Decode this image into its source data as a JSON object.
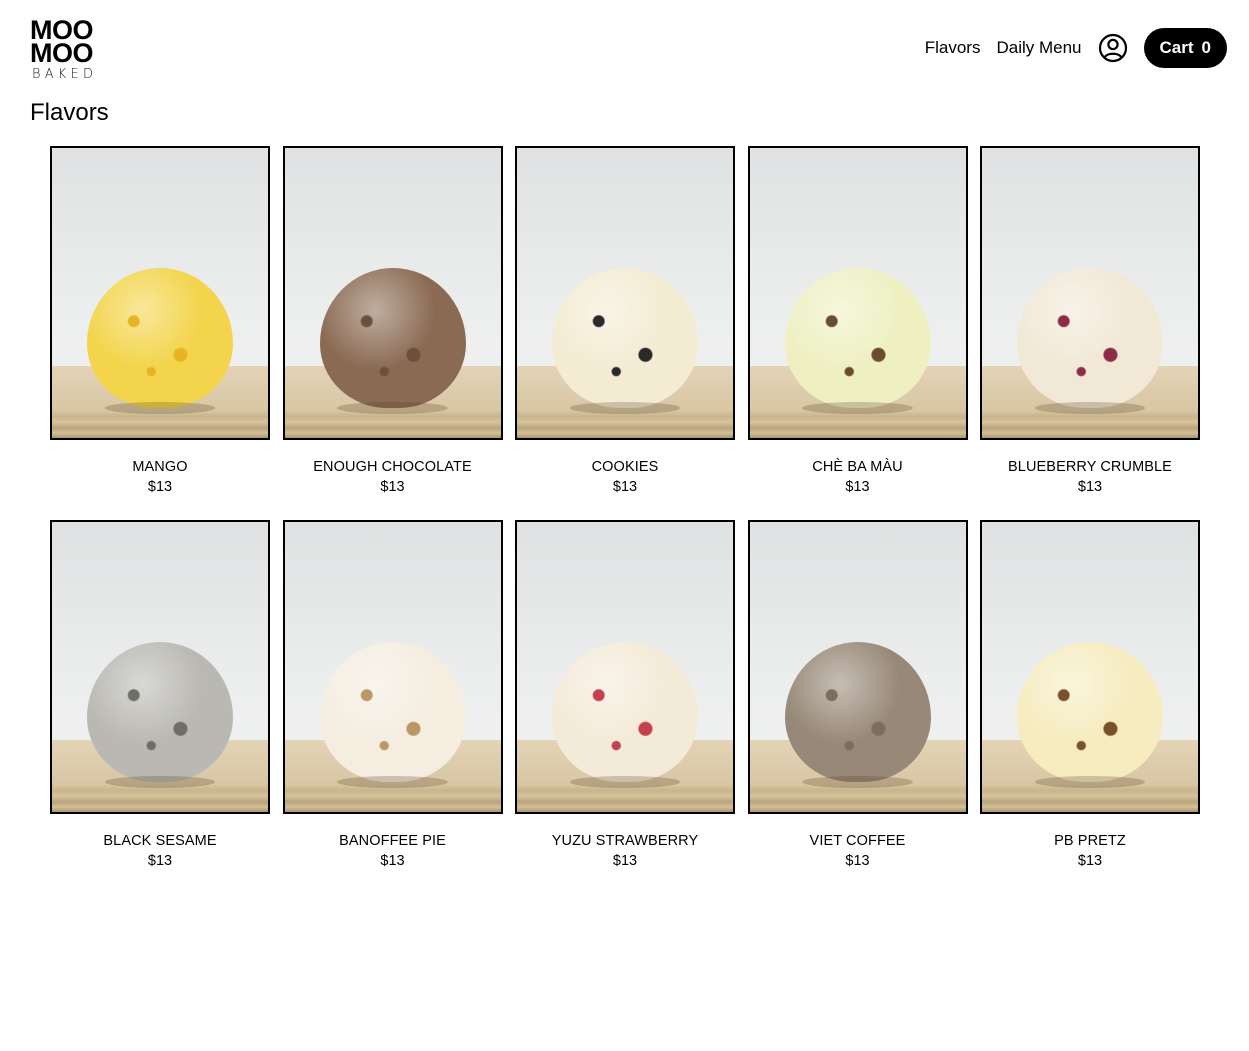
{
  "logo": {
    "line1": "MOO",
    "line2": "MOO",
    "line3": "BAKED"
  },
  "nav": {
    "flavors": "Flavors",
    "daily_menu": "Daily Menu",
    "cart_label": "Cart",
    "cart_count": "0"
  },
  "page": {
    "title": "Flavors"
  },
  "products": [
    {
      "name": "MANGO",
      "price": "$13",
      "color": "#f3d44a",
      "accent": "#e7b524"
    },
    {
      "name": "ENOUGH CHOCOLATE",
      "price": "$13",
      "color": "#8a6a52",
      "accent": "#6d4f3a"
    },
    {
      "name": "COOKIES",
      "price": "$13",
      "color": "#f3ecd3",
      "accent": "#2a2a2a"
    },
    {
      "name": "CHÈ BA MÀU",
      "price": "$13",
      "color": "#eef0c2",
      "accent": "#6b4c2e"
    },
    {
      "name": "BLUEBERRY CRUMBLE",
      "price": "$13",
      "color": "#f1e8d6",
      "accent": "#8e2c48"
    },
    {
      "name": "BLACK SESAME",
      "price": "$13",
      "color": "#b9b8b2",
      "accent": "#6e6d66"
    },
    {
      "name": "BANOFFEE PIE",
      "price": "$13",
      "color": "#f4ede0",
      "accent": "#b99866"
    },
    {
      "name": "YUZU STRAWBERRY",
      "price": "$13",
      "color": "#f4ead8",
      "accent": "#c5404f"
    },
    {
      "name": "VIET COFFEE",
      "price": "$13",
      "color": "#978877",
      "accent": "#7c6d5d"
    },
    {
      "name": "PB PRETZ",
      "price": "$13",
      "color": "#f6ecbf",
      "accent": "#7a5228"
    }
  ]
}
